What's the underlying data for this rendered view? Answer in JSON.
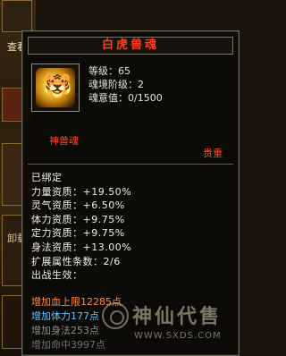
{
  "background": {
    "left_labels": [
      "查看",
      "卸载"
    ]
  },
  "tooltip": {
    "title": "白虎兽魂",
    "icon": "white-tiger-soul-icon",
    "stats": [
      "等级：65",
      "魂境阶级：2",
      "魂意值：0/1500"
    ],
    "subtitle": "神兽魂",
    "rarity": "贵重",
    "attributes": [
      "已绑定",
      "力量资质：+19.50%",
      "灵气资质：+6.50%",
      "体力资质：+9.75%",
      "定力资质：+9.75%",
      "身法资质：+13.00%",
      "扩展属性条数：2/6",
      "出战生效："
    ],
    "effects": [
      "增加血上限12285点",
      "增加体力177点",
      "增加身法253点",
      "增加命中3997点"
    ]
  },
  "watermark": {
    "name": "神仙代售",
    "url": "WWW.SXDS.COM"
  },
  "colors": {
    "title": "#ff3c1e",
    "orange_effect": "#ff8c3a",
    "blue_effect": "#5ec8ff",
    "gray_effect": "#8c8c8c"
  }
}
